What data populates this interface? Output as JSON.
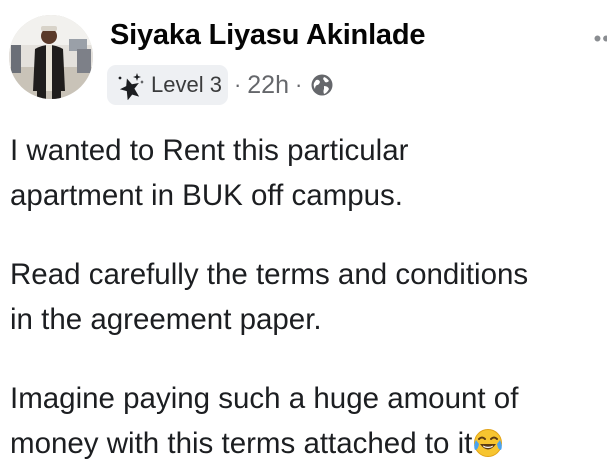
{
  "post": {
    "author": {
      "name": "Siyaka Liyasu Akinlade",
      "avatar_icon": "profile-photo"
    },
    "badge": {
      "icon": "rising-star-icon",
      "label": "Level 3"
    },
    "separator": "·",
    "timestamp": "22h",
    "audience_icon": "globe-icon",
    "more_icon": "more-options-icon",
    "lines": [
      "I wanted to Rent this particular",
      "apartment in BUK off campus.",
      "Read carefully the terms and conditions",
      "in the agreement paper.",
      "Imagine paying such a huge amount of",
      "money with this terms attached to it"
    ],
    "trailing_emoji": "face-with-tears-of-joy-icon"
  },
  "colors": {
    "text": "#1c1e21",
    "meta": "#65676b",
    "badge_bg": "#eef0f3"
  }
}
